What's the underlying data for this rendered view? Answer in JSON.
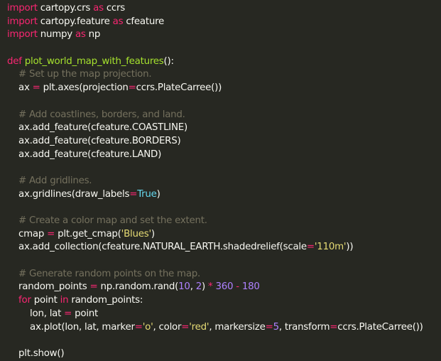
{
  "colors": {
    "background": "#272822",
    "text": "#f8f8f2",
    "keyword": "#f92672",
    "function": "#a6e22e",
    "comment": "#75715e",
    "number": "#ae81ff",
    "string": "#e6db74",
    "builtin": "#66d9ef"
  },
  "code": {
    "lines": [
      [
        {
          "t": "import",
          "c": "kw"
        },
        {
          "t": " cartopy.crs ",
          "c": "plain"
        },
        {
          "t": "as",
          "c": "kw"
        },
        {
          "t": " ccrs",
          "c": "plain"
        }
      ],
      [
        {
          "t": "import",
          "c": "kw"
        },
        {
          "t": " cartopy.feature ",
          "c": "plain"
        },
        {
          "t": "as",
          "c": "kw"
        },
        {
          "t": " cfeature",
          "c": "plain"
        }
      ],
      [
        {
          "t": "import",
          "c": "kw"
        },
        {
          "t": " numpy ",
          "c": "plain"
        },
        {
          "t": "as",
          "c": "kw"
        },
        {
          "t": " np",
          "c": "plain"
        }
      ],
      [],
      [
        {
          "t": "def",
          "c": "kw"
        },
        {
          "t": " ",
          "c": "plain"
        },
        {
          "t": "plot_world_map_with_features",
          "c": "fn"
        },
        {
          "t": "():",
          "c": "plain"
        }
      ],
      [
        {
          "t": "    ",
          "c": "plain"
        },
        {
          "t": "# Set up the map projection.",
          "c": "cm"
        }
      ],
      [
        {
          "t": "    ax ",
          "c": "plain"
        },
        {
          "t": "=",
          "c": "kw"
        },
        {
          "t": " plt.axes(projection",
          "c": "plain"
        },
        {
          "t": "=",
          "c": "kw"
        },
        {
          "t": "ccrs.PlateCarree())",
          "c": "plain"
        }
      ],
      [],
      [
        {
          "t": "    ",
          "c": "plain"
        },
        {
          "t": "# Add coastlines, borders, and land.",
          "c": "cm"
        }
      ],
      [
        {
          "t": "    ax.add_feature(cfeature.COASTLINE)",
          "c": "plain"
        }
      ],
      [
        {
          "t": "    ax.add_feature(cfeature.BORDERS)",
          "c": "plain"
        }
      ],
      [
        {
          "t": "    ax.add_feature(cfeature.LAND)",
          "c": "plain"
        }
      ],
      [],
      [
        {
          "t": "    ",
          "c": "plain"
        },
        {
          "t": "# Add gridlines.",
          "c": "cm"
        }
      ],
      [
        {
          "t": "    ax.gridlines(draw_labels",
          "c": "plain"
        },
        {
          "t": "=",
          "c": "kw"
        },
        {
          "t": "True",
          "c": "bi"
        },
        {
          "t": ")",
          "c": "plain"
        }
      ],
      [],
      [
        {
          "t": "    ",
          "c": "plain"
        },
        {
          "t": "# Create a color map and set the extent.",
          "c": "cm"
        }
      ],
      [
        {
          "t": "    cmap ",
          "c": "plain"
        },
        {
          "t": "=",
          "c": "kw"
        },
        {
          "t": " plt.get_cmap(",
          "c": "plain"
        },
        {
          "t": "'Blues'",
          "c": "str"
        },
        {
          "t": ")",
          "c": "plain"
        }
      ],
      [
        {
          "t": "    ax.add_collection(cfeature.NATURAL_EARTH.shadedrelief(scale",
          "c": "plain"
        },
        {
          "t": "=",
          "c": "kw"
        },
        {
          "t": "'110m'",
          "c": "str"
        },
        {
          "t": "))",
          "c": "plain"
        }
      ],
      [],
      [
        {
          "t": "    ",
          "c": "plain"
        },
        {
          "t": "# Generate random points on the map.",
          "c": "cm"
        }
      ],
      [
        {
          "t": "    random_points ",
          "c": "plain"
        },
        {
          "t": "=",
          "c": "kw"
        },
        {
          "t": " np.random.rand(",
          "c": "plain"
        },
        {
          "t": "10",
          "c": "num"
        },
        {
          "t": ", ",
          "c": "plain"
        },
        {
          "t": "2",
          "c": "num"
        },
        {
          "t": ") ",
          "c": "plain"
        },
        {
          "t": "*",
          "c": "kw"
        },
        {
          "t": " ",
          "c": "plain"
        },
        {
          "t": "360",
          "c": "num"
        },
        {
          "t": " ",
          "c": "plain"
        },
        {
          "t": "-",
          "c": "kw"
        },
        {
          "t": " ",
          "c": "plain"
        },
        {
          "t": "180",
          "c": "num"
        }
      ],
      [
        {
          "t": "    ",
          "c": "plain"
        },
        {
          "t": "for",
          "c": "kw"
        },
        {
          "t": " point ",
          "c": "plain"
        },
        {
          "t": "in",
          "c": "kw"
        },
        {
          "t": " random_points:",
          "c": "plain"
        }
      ],
      [
        {
          "t": "        lon, lat ",
          "c": "plain"
        },
        {
          "t": "=",
          "c": "kw"
        },
        {
          "t": " point",
          "c": "plain"
        }
      ],
      [
        {
          "t": "        ax.plot(lon, lat, marker",
          "c": "plain"
        },
        {
          "t": "=",
          "c": "kw"
        },
        {
          "t": "'o'",
          "c": "str"
        },
        {
          "t": ", color",
          "c": "plain"
        },
        {
          "t": "=",
          "c": "kw"
        },
        {
          "t": "'red'",
          "c": "str"
        },
        {
          "t": ", markersize",
          "c": "plain"
        },
        {
          "t": "=",
          "c": "kw"
        },
        {
          "t": "5",
          "c": "num"
        },
        {
          "t": ", transform",
          "c": "plain"
        },
        {
          "t": "=",
          "c": "kw"
        },
        {
          "t": "ccrs.PlateCarree())",
          "c": "plain"
        }
      ],
      [],
      [
        {
          "t": "    plt.show()",
          "c": "plain"
        }
      ]
    ]
  }
}
